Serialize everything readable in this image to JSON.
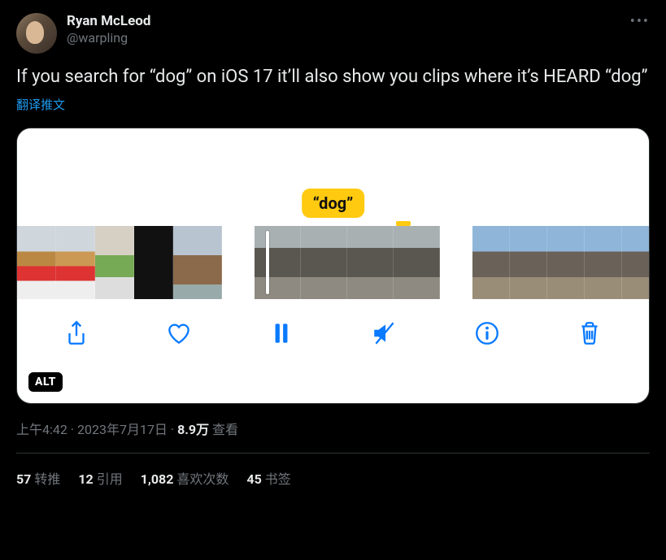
{
  "author": {
    "display_name": "Ryan McLeod",
    "handle": "@warpling"
  },
  "tweet_text": "If you search for “dog” on iOS 17 it’ll also show you clips where it’s HEARD “dog”",
  "translate_label": "翻译推文",
  "media": {
    "highlight_label": "“dog”",
    "alt_badge": "ALT"
  },
  "meta": {
    "time": "上午4:42",
    "date": "2023年7月17日",
    "separator": " · ",
    "views_count": "8.9万",
    "views_label": " 查看"
  },
  "stats": {
    "retweets_count": "57",
    "retweets_label": "转推",
    "quotes_count": "12",
    "quotes_label": "引用",
    "likes_count": "1,082",
    "likes_label": "喜欢次数",
    "bookmarks_count": "45",
    "bookmarks_label": "书签"
  }
}
